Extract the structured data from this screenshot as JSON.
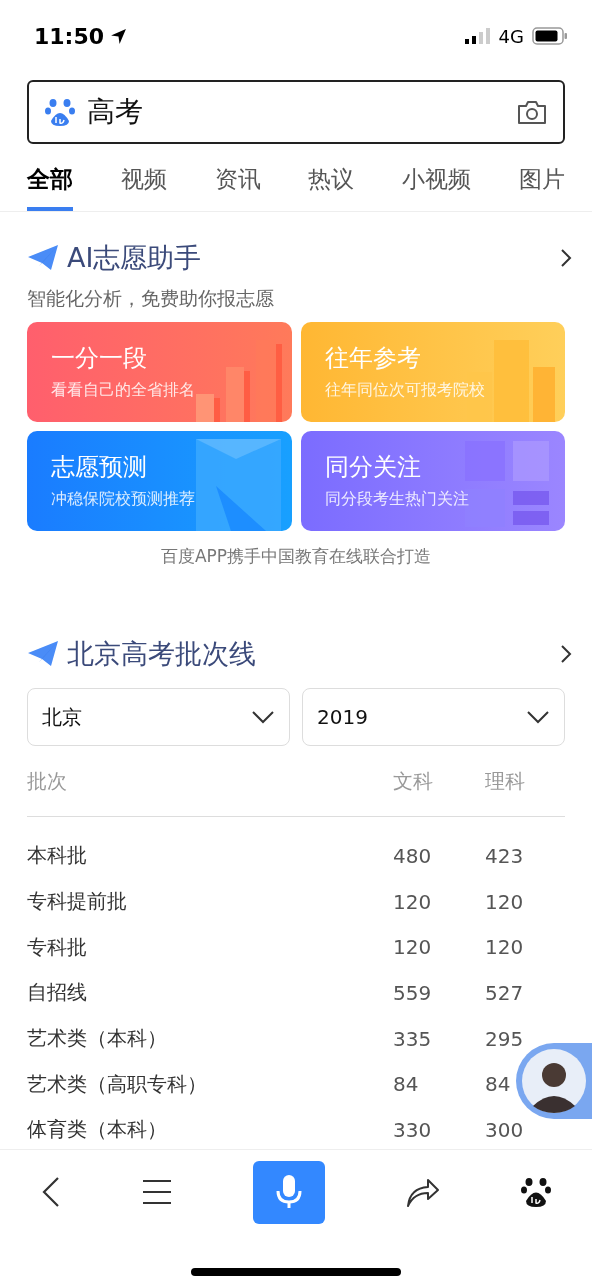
{
  "status_bar": {
    "time": "11:50",
    "network": "4G"
  },
  "search": {
    "value": "高考"
  },
  "tabs": [
    {
      "label": "全部",
      "selected": true
    },
    {
      "label": "视频",
      "selected": false
    },
    {
      "label": "资讯",
      "selected": false
    },
    {
      "label": "热议",
      "selected": false
    },
    {
      "label": "小视频",
      "selected": false
    },
    {
      "label": "图片",
      "selected": false
    }
  ],
  "ai_helper": {
    "title": "AI志愿助手",
    "subtitle": "智能化分析，免费助你报志愿",
    "cards": [
      {
        "kind": "rank",
        "title": "一分一段",
        "subtitle": "看看自己的全省排名"
      },
      {
        "kind": "history",
        "title": "往年参考",
        "subtitle": "往年同位次可报考院校"
      },
      {
        "kind": "predict",
        "title": "志愿预测",
        "subtitle": "冲稳保院校预测推荐"
      },
      {
        "kind": "follow",
        "title": "同分关注",
        "subtitle": "同分段考生热门关注"
      }
    ],
    "footer": "百度APP携手中国教育在线联合打造"
  },
  "score_lines": {
    "title": "北京高考批次线",
    "selects": [
      {
        "value": "北京"
      },
      {
        "value": "2019"
      }
    ],
    "table": {
      "columns": [
        "批次",
        "文科",
        "理科"
      ],
      "rows": [
        [
          "本科批",
          "480",
          "423"
        ],
        [
          "专科提前批",
          "120",
          "120"
        ],
        [
          "专科批",
          "120",
          "120"
        ],
        [
          "自招线",
          "559",
          "527"
        ],
        [
          "艺术类（本科）",
          "335",
          "295"
        ],
        [
          "艺术类（高职专科）",
          "84",
          "84"
        ],
        [
          "体育类（本科）",
          "330",
          "300"
        ]
      ]
    }
  }
}
